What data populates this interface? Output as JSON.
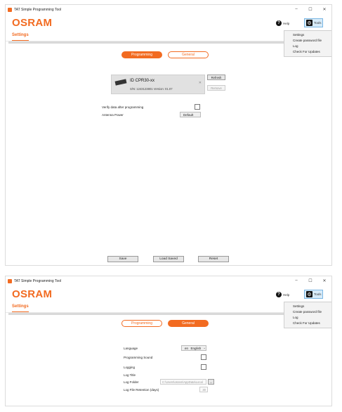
{
  "window": {
    "title": "TAT Simple Programming Tool",
    "controls": {
      "minimize": "–",
      "maximize": "☐",
      "close": "✕"
    }
  },
  "header": {
    "logo": "OSRAM",
    "help_label": "Help",
    "tools_label": "Tools"
  },
  "tabs": {
    "settings": "Settings"
  },
  "tools_menu": {
    "items": [
      "Settings",
      "Create password file",
      "Log",
      "Check For Updates"
    ]
  },
  "segments": {
    "programming": "Programming",
    "general": "General"
  },
  "programming": {
    "device": {
      "name": "ID CPR30-xx",
      "sn_line": "S/N: 1243123801   Version: 01.07",
      "remove_icon": "✕"
    },
    "refresh_label": "Refresh",
    "remove_label": "Remove",
    "verify_label": "Verify data after programming",
    "verify_checked": false,
    "antenna_label": "Antenna Power",
    "antenna_value": "Default",
    "save_label": "Save",
    "load_saved_label": "Load Saved",
    "reset_label": "Reset"
  },
  "general": {
    "language_label": "Language",
    "language_code": "en",
    "language_value": "English",
    "sound_label": "Programming Sound",
    "sound_checked": false,
    "logging_label": "Logging",
    "logging_checked": false,
    "log_title_label": "Log Title",
    "log_folder_label": "Log Folder",
    "log_folder_value": "C:\\Users\\osram\\AppData\\Local",
    "browse_label": "...",
    "retention_label": "Log File Retention (days)",
    "retention_value": "30"
  },
  "icons": {
    "app": "app-icon",
    "help": "help-icon",
    "gear": "gear-icon",
    "device": "reader-icon"
  },
  "colors": {
    "accent": "#f26b21",
    "tools_highlight": "#d7ebf9"
  }
}
